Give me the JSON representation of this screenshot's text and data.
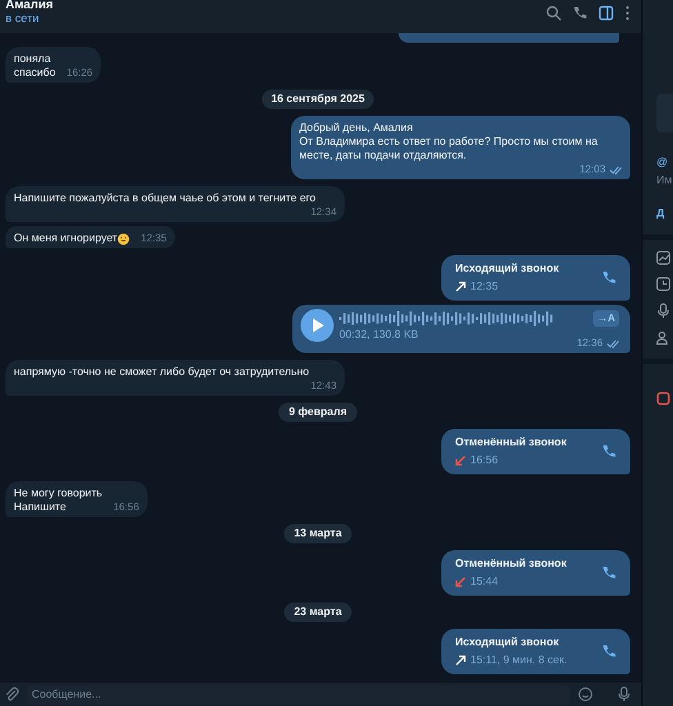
{
  "header": {
    "title": "Амалия",
    "status": "в сети",
    "panel_open": true
  },
  "messages": [
    {
      "kind": "text",
      "outgoing": false,
      "text": "поняла\nспасибо",
      "time": "16:26"
    },
    {
      "kind": "date",
      "text": "16 сентября 2025"
    },
    {
      "kind": "text",
      "outgoing": true,
      "text": "Добрый день, Амалия\nОт Владимира есть ответ по работе? Просто мы стоим на месте, даты подачи отдаляются.",
      "time": "12:03",
      "read": true
    },
    {
      "kind": "text",
      "outgoing": false,
      "text": "Напишите пожалуйста в общем чаье об этом и тегните его",
      "time": "12:34"
    },
    {
      "kind": "text",
      "outgoing": false,
      "text": "Он меня игнорирует",
      "emoji": true,
      "time": "12:35"
    },
    {
      "kind": "call",
      "outgoing": true,
      "title": "Исходящий звонок",
      "cancelled": false,
      "info": "12:35"
    },
    {
      "kind": "voice",
      "outgoing": true,
      "meta": "00:32, 130.8 KB",
      "transcribe": "→A",
      "time": "12:36",
      "read": true
    },
    {
      "kind": "text",
      "outgoing": false,
      "text": "напрямую -точно не сможет либо будет оч затрудительно",
      "time": "12:43"
    },
    {
      "kind": "date",
      "text": "9 февраля"
    },
    {
      "kind": "call",
      "outgoing": true,
      "title": "Отменённый звонок",
      "cancelled": true,
      "info": "16:56"
    },
    {
      "kind": "text",
      "outgoing": false,
      "text": "Не могу говорить\nНапишите",
      "time": "16:56"
    },
    {
      "kind": "date",
      "text": "13 марта"
    },
    {
      "kind": "call",
      "outgoing": true,
      "title": "Отменённый звонок",
      "cancelled": true,
      "info": "15:44"
    },
    {
      "kind": "date",
      "text": "23 марта"
    },
    {
      "kind": "call",
      "outgoing": true,
      "title": "Исходящий звонок",
      "cancelled": false,
      "info": "15:11, 9 мин. 8 сек."
    }
  ],
  "composer": {
    "placeholder": "Сообщение..."
  },
  "side_panel": {
    "username": "@",
    "label": "Им",
    "link": "Д"
  }
}
